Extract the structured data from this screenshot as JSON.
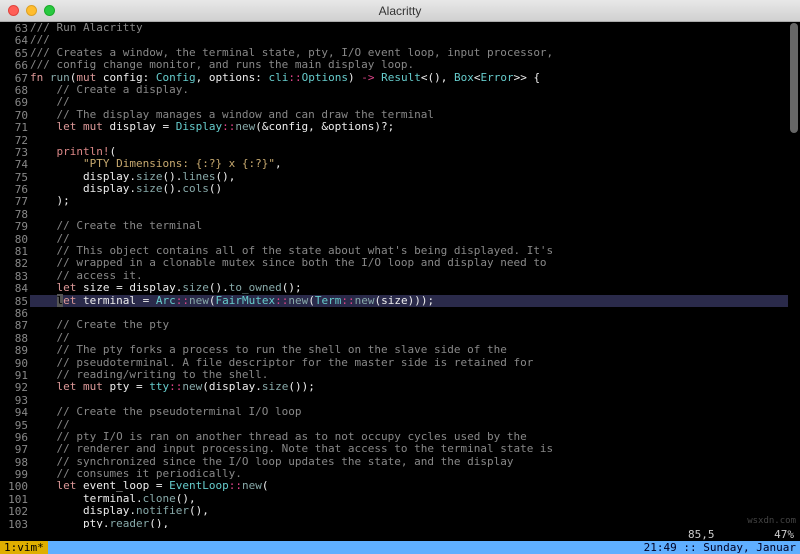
{
  "window": {
    "title": "Alacritty"
  },
  "gutter_start": 63,
  "gutter_end": 103,
  "lines": [
    [
      [
        "/// Run Alacritty",
        "c-cmt"
      ]
    ],
    [
      [
        "///",
        "c-cmt"
      ]
    ],
    [
      [
        "/// Creates a window, the terminal state, pty, I/O event loop, input processor,",
        "c-cmt"
      ]
    ],
    [
      [
        "/// config change monitor, and runs the main display loop.",
        "c-cmt"
      ]
    ],
    [
      [
        "fn ",
        "c-kw"
      ],
      [
        "run",
        "c-fn"
      ],
      [
        "(",
        "c-id"
      ],
      [
        "mut ",
        "c-kw"
      ],
      [
        "config: ",
        "c-id"
      ],
      [
        "Config",
        "c-ty"
      ],
      [
        ", options: ",
        "c-id"
      ],
      [
        "cli",
        "c-ty"
      ],
      [
        "::",
        "c-op"
      ],
      [
        "Options",
        "c-ty"
      ],
      [
        ") ",
        "c-id"
      ],
      [
        "-> ",
        "c-op"
      ],
      [
        "Result",
        "c-ty"
      ],
      [
        "<(), ",
        "c-id"
      ],
      [
        "Box",
        "c-ty"
      ],
      [
        "<",
        "c-id"
      ],
      [
        "Error",
        "c-ty"
      ],
      [
        ">> {",
        "c-id"
      ]
    ],
    [
      [
        "    // Create a display.",
        "c-cmt"
      ]
    ],
    [
      [
        "    //",
        "c-cmt"
      ]
    ],
    [
      [
        "    // The display manages a window and can draw the terminal",
        "c-cmt"
      ]
    ],
    [
      [
        "    ",
        "c-id"
      ],
      [
        "let mut ",
        "c-kw"
      ],
      [
        "display = ",
        "c-id"
      ],
      [
        "Display",
        "c-ty"
      ],
      [
        "::",
        "c-op"
      ],
      [
        "new",
        "c-fn"
      ],
      [
        "(&config, &options)?;",
        "c-id"
      ]
    ],
    [
      [
        "",
        ""
      ]
    ],
    [
      [
        "    ",
        "c-id"
      ],
      [
        "println!",
        "c-mac"
      ],
      [
        "(",
        "c-id"
      ]
    ],
    [
      [
        "        ",
        "c-id"
      ],
      [
        "\"PTY Dimensions: {:?} x {:?}\"",
        "c-str"
      ],
      [
        ",",
        "c-id"
      ]
    ],
    [
      [
        "        display.",
        "c-id"
      ],
      [
        "size",
        "c-fn"
      ],
      [
        "().",
        "c-id"
      ],
      [
        "lines",
        "c-fn"
      ],
      [
        "(),",
        "c-id"
      ]
    ],
    [
      [
        "        display.",
        "c-id"
      ],
      [
        "size",
        "c-fn"
      ],
      [
        "().",
        "c-id"
      ],
      [
        "cols",
        "c-fn"
      ],
      [
        "()",
        "c-id"
      ]
    ],
    [
      [
        "    );",
        "c-id"
      ]
    ],
    [
      [
        "",
        ""
      ]
    ],
    [
      [
        "    // Create the terminal",
        "c-cmt"
      ]
    ],
    [
      [
        "    //",
        "c-cmt"
      ]
    ],
    [
      [
        "    // This object contains all of the state about what's being displayed. It's",
        "c-cmt"
      ]
    ],
    [
      [
        "    // wrapped in a clonable mutex since both the I/O loop and display need to",
        "c-cmt"
      ]
    ],
    [
      [
        "    // access it.",
        "c-cmt"
      ]
    ],
    [
      [
        "    ",
        "c-id"
      ],
      [
        "let ",
        "c-kw"
      ],
      [
        "size = display.",
        "c-id"
      ],
      [
        "size",
        "c-fn"
      ],
      [
        "().",
        "c-id"
      ],
      [
        "to_owned",
        "c-fn"
      ],
      [
        "();",
        "c-id"
      ]
    ],
    [
      [
        "    ",
        "c-id"
      ],
      [
        "l",
        "cursor"
      ],
      [
        "et ",
        "c-kw"
      ],
      [
        "terminal = ",
        "c-id"
      ],
      [
        "Arc",
        "c-ty"
      ],
      [
        "::",
        "c-op"
      ],
      [
        "new",
        "c-fn"
      ],
      [
        "(",
        "c-id"
      ],
      [
        "FairMutex",
        "c-ty"
      ],
      [
        "::",
        "c-op"
      ],
      [
        "new",
        "c-fn"
      ],
      [
        "(",
        "c-id"
      ],
      [
        "Term",
        "c-ty"
      ],
      [
        "::",
        "c-op"
      ],
      [
        "new",
        "c-fn"
      ],
      [
        "(size)));",
        "c-id"
      ]
    ],
    [
      [
        "",
        ""
      ]
    ],
    [
      [
        "    // Create the pty",
        "c-cmt"
      ]
    ],
    [
      [
        "    //",
        "c-cmt"
      ]
    ],
    [
      [
        "    // The pty forks a process to run the shell on the slave side of the",
        "c-cmt"
      ]
    ],
    [
      [
        "    // pseudoterminal. A file descriptor for the master side is retained for",
        "c-cmt"
      ]
    ],
    [
      [
        "    // reading/writing to the shell.",
        "c-cmt"
      ]
    ],
    [
      [
        "    ",
        "c-id"
      ],
      [
        "let mut ",
        "c-kw"
      ],
      [
        "pty = ",
        "c-id"
      ],
      [
        "tty",
        "c-ty"
      ],
      [
        "::",
        "c-op"
      ],
      [
        "new",
        "c-fn"
      ],
      [
        "(display.",
        "c-id"
      ],
      [
        "size",
        "c-fn"
      ],
      [
        "());",
        "c-id"
      ]
    ],
    [
      [
        "",
        ""
      ]
    ],
    [
      [
        "    // Create the pseudoterminal I/O loop",
        "c-cmt"
      ]
    ],
    [
      [
        "    //",
        "c-cmt"
      ]
    ],
    [
      [
        "    // pty I/O is ran on another thread as to not occupy cycles used by the",
        "c-cmt"
      ]
    ],
    [
      [
        "    // renderer and input processing. Note that access to the terminal state is",
        "c-cmt"
      ]
    ],
    [
      [
        "    // synchronized since the I/O loop updates the state, and the display",
        "c-cmt"
      ]
    ],
    [
      [
        "    // consumes it periodically.",
        "c-cmt"
      ]
    ],
    [
      [
        "    ",
        "c-id"
      ],
      [
        "let ",
        "c-kw"
      ],
      [
        "event_loop = ",
        "c-id"
      ],
      [
        "EventLoop",
        "c-ty"
      ],
      [
        "::",
        "c-op"
      ],
      [
        "new",
        "c-fn"
      ],
      [
        "(",
        "c-id"
      ]
    ],
    [
      [
        "        terminal.",
        "c-id"
      ],
      [
        "clone",
        "c-fn"
      ],
      [
        "(),",
        "c-id"
      ]
    ],
    [
      [
        "        display.",
        "c-id"
      ],
      [
        "notifier",
        "c-fn"
      ],
      [
        "(),",
        "c-id"
      ]
    ],
    [
      [
        "        pty.",
        "c-id"
      ],
      [
        "reader",
        "c-fn"
      ],
      [
        "(),",
        "c-id"
      ]
    ]
  ],
  "status": {
    "pos": "85,5",
    "pct": "47%"
  },
  "tabline": {
    "left": "1:vim*",
    "right": "21:49 :: Sunday, Januar"
  },
  "watermark": "wsxdn.com"
}
